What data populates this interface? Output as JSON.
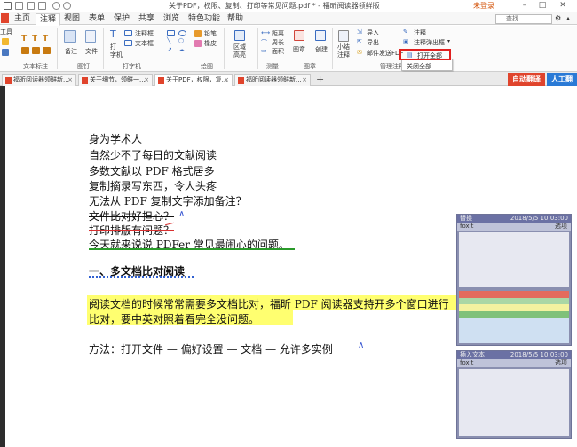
{
  "window": {
    "title": "关于PDF，权限、复制、打印等常见问题.pdf * - 福昕阅读器领鲜版",
    "login": "未登录"
  },
  "menu_tabs": [
    "主页",
    "注释",
    "视图",
    "表单",
    "保护",
    "共享",
    "浏览",
    "特色功能",
    "帮助"
  ],
  "active_tab": "注释",
  "search": {
    "placeholder": "查找"
  },
  "ribbon": {
    "left_cut_label": "工具",
    "text_tools": [
      "T",
      "T",
      "T"
    ],
    "note_label": "备注",
    "file_label": "文件",
    "pin_label": "图钉",
    "typewriter_label": "打\n字机",
    "callout_label": "注释框",
    "textbox_label": "文本框",
    "typewriter_group": "打字机",
    "pencil_label": "铅笔",
    "eraser_label": "橡皮",
    "drawing_group": "绘图",
    "highlight_area_label": "区域\n高亮",
    "distance_label": "距离",
    "perimeter_label": "周长",
    "area_label": "面积",
    "measure_group": "测量",
    "stamp_label": "图章",
    "create_label": "创建",
    "stamp_group": "图章",
    "summarize_label": "小结\n注释",
    "import_label": "导入",
    "export_label": "导出",
    "email_label": "邮件发送FDF",
    "manage_group": "管理注释",
    "notes_dropdown_label": "注释",
    "popup_label": "注释弹出框",
    "open_all_label": "打开全部",
    "close_all_label": "关闭全部",
    "text_label_group": "文本标注",
    "misc_group": "图钉"
  },
  "doc_tabs": [
    {
      "label": "福昕阅读器领鲜新..."
    },
    {
      "label": "关于细节，领鲜一..."
    },
    {
      "label": "关于PDF，权限，复..."
    },
    {
      "label": "福昕阅读器领鲜新..."
    }
  ],
  "translate": {
    "auto": "自动翻译",
    "manual": "人工翻"
  },
  "document": {
    "lines": [
      "身为学术人",
      "自然少不了每日的文献阅读",
      "多数文献以 PDF 格式居多",
      "复制摘录写东西，令人头疼",
      "无法从 PDF 复制文字添加备注？",
      "文件比对好担心？",
      "打印排版有问题？",
      "今天就来说说 PDFer 常见最闹心的问题。"
    ],
    "heading": "一、多文档比对阅读",
    "para_line1": "阅读文档的时候常常需要多文档比对，福昕 PDF 阅读器支持开多个窗口进行",
    "para_line2": "比对，要中英对照着看完全没问题。",
    "method": "方法：打开文件  —  偏好设置  —  文档  —  允许多实例"
  },
  "notes": [
    {
      "type": "替换",
      "date": "2018/5/5 10:03:00",
      "author": "foxit",
      "options": "选项"
    },
    {
      "type": "插入文本",
      "date": "2018/5/5 10:03:00",
      "author": "foxit",
      "options": "选项"
    }
  ],
  "colors": {
    "accent_red": "#e0442c",
    "translate_auto": "#e0442c",
    "translate_manual": "#2a7ad6",
    "highlight_yellow": "#ffff70",
    "note_header": "#6b71a4"
  }
}
